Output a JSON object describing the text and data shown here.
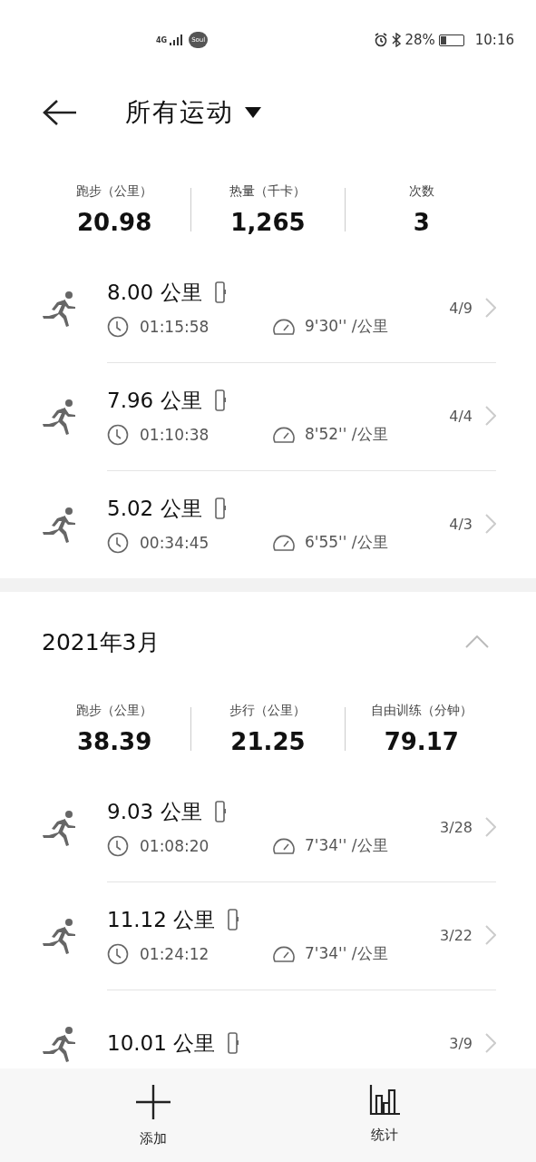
{
  "status_bar": {
    "network": "4G",
    "app_badge": "Soul",
    "battery_text": "28%",
    "time": "10:16"
  },
  "header": {
    "title": "所有运动"
  },
  "sections": [
    {
      "summary": [
        {
          "label": "跑步（公里）",
          "value": "20.98"
        },
        {
          "label": "热量（千卡）",
          "value": "1,265"
        },
        {
          "label": "次数",
          "value": "3"
        }
      ],
      "workouts": [
        {
          "distance": "8.00 公里",
          "duration": "01:15:58",
          "pace": "9'30'' /公里",
          "date": "4/9"
        },
        {
          "distance": "7.96 公里",
          "duration": "01:10:38",
          "pace": "8'52'' /公里",
          "date": "4/4"
        },
        {
          "distance": "5.02 公里",
          "duration": "00:34:45",
          "pace": "6'55'' /公里",
          "date": "4/3"
        }
      ]
    },
    {
      "month": "2021年3月",
      "expanded": true,
      "summary": [
        {
          "label": "跑步（公里）",
          "value": "38.39"
        },
        {
          "label": "步行（公里）",
          "value": "21.25"
        },
        {
          "label": "自由训练（分钟）",
          "value": "79.17"
        }
      ],
      "workouts": [
        {
          "distance": "9.03 公里",
          "duration": "01:08:20",
          "pace": "7'34'' /公里",
          "date": "3/28"
        },
        {
          "distance": "11.12 公里",
          "duration": "01:24:12",
          "pace": "7'34'' /公里",
          "date": "3/22"
        },
        {
          "distance": "10.01 公里",
          "date": "3/9"
        }
      ]
    }
  ],
  "bottom_nav": [
    {
      "label": "添加",
      "kind": "add"
    },
    {
      "label": "统计",
      "kind": "stats"
    }
  ]
}
